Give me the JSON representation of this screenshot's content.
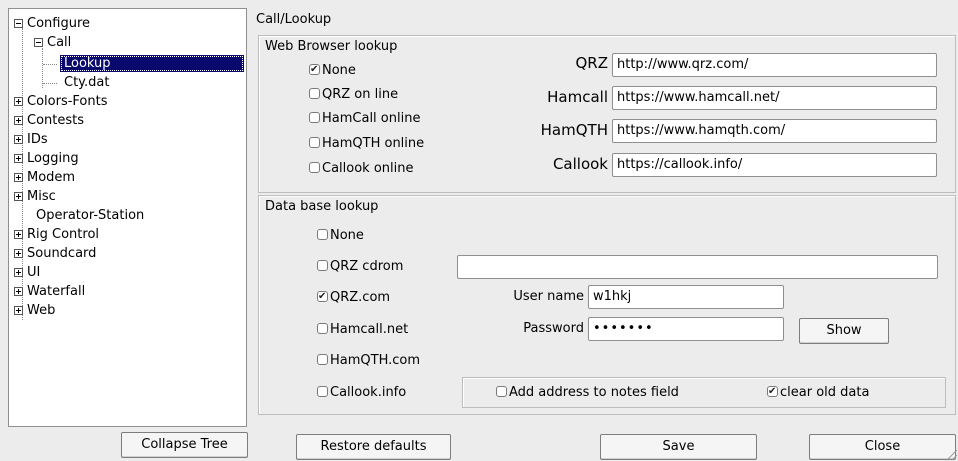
{
  "tree": {
    "items": [
      {
        "label": "Configure",
        "toggle": "minus"
      },
      {
        "label": "Call",
        "toggle": "minus"
      },
      {
        "label": "Lookup",
        "selected": true
      },
      {
        "label": "Cty.dat"
      },
      {
        "label": "Colors-Fonts",
        "toggle": "plus"
      },
      {
        "label": "Contests",
        "toggle": "plus"
      },
      {
        "label": "IDs",
        "toggle": "plus"
      },
      {
        "label": "Logging",
        "toggle": "plus"
      },
      {
        "label": "Modem",
        "toggle": "plus"
      },
      {
        "label": "Misc",
        "toggle": "plus"
      },
      {
        "label": "Operator-Station"
      },
      {
        "label": "Rig Control",
        "toggle": "plus"
      },
      {
        "label": "Soundcard",
        "toggle": "plus"
      },
      {
        "label": "UI",
        "toggle": "plus"
      },
      {
        "label": "Waterfall",
        "toggle": "plus"
      },
      {
        "label": "Web",
        "toggle": "plus"
      }
    ]
  },
  "panel_title": "Call/Lookup",
  "web_browser": {
    "group_label": "Web Browser lookup",
    "options": [
      {
        "label": "None",
        "checked": true
      },
      {
        "label": "QRZ on line",
        "checked": false
      },
      {
        "label": "HamCall online",
        "checked": false
      },
      {
        "label": "HamQTH online",
        "checked": false
      },
      {
        "label": "Callook online",
        "checked": false
      }
    ],
    "urls": [
      {
        "label": "QRZ",
        "value": "http://www.qrz.com/"
      },
      {
        "label": "Hamcall",
        "value": "https://www.hamcall.net/"
      },
      {
        "label": "HamQTH",
        "value": "https://www.hamqth.com/"
      },
      {
        "label": "Callook",
        "value": "https://callook.info/"
      }
    ]
  },
  "database": {
    "group_label": "Data base lookup",
    "options": [
      {
        "label": "None",
        "checked": false
      },
      {
        "label": "QRZ cdrom",
        "checked": false
      },
      {
        "label": "QRZ.com",
        "checked": true
      },
      {
        "label": "Hamcall.net",
        "checked": false
      },
      {
        "label": "HamQTH.com",
        "checked": false
      },
      {
        "label": "Callook.info",
        "checked": false
      }
    ],
    "cdrom_path": "",
    "username_label": "User name",
    "username": "w1hkj",
    "password_label": "Password",
    "password": "•••••••",
    "show_label": "Show",
    "add_address_label": "Add address to notes field",
    "add_address_checked": false,
    "clear_old_label": "clear old data",
    "clear_old_checked": true
  },
  "buttons": {
    "collapse": "Collapse Tree",
    "restore": "Restore defaults",
    "save": "Save",
    "close": "Close"
  }
}
